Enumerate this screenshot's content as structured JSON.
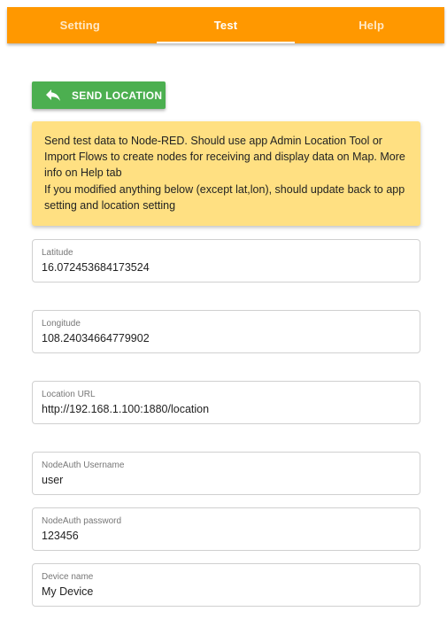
{
  "tabs": [
    {
      "label": "Setting"
    },
    {
      "label": "Test"
    },
    {
      "label": "Help"
    }
  ],
  "active_tab": "Test",
  "send_button": {
    "label": "SEND LOCATION",
    "icon": "reply-arrow-icon"
  },
  "notice": {
    "line1": "Send test data to Node-RED. Should use app Admin Location Tool or Import Flows to create nodes for receiving and display data on Map. More info on Help tab",
    "line2": "If you modified anything below (except lat,lon), should update back to app setting and location setting"
  },
  "fields": {
    "latitude": {
      "label": "Latitude",
      "value": "16.072453684173524"
    },
    "longitude": {
      "label": "Longitude",
      "value": "108.24034664779902"
    },
    "location_url": {
      "label": "Location URL",
      "value": "http://192.168.1.100:1880/location"
    },
    "username": {
      "label": "NodeAuth Username",
      "value": "user"
    },
    "password": {
      "label": "NodeAuth password",
      "value": "123456"
    },
    "device_name": {
      "label": "Device name",
      "value": "My Device"
    }
  },
  "colors": {
    "tabbar": "#ff9800",
    "send_button": "#4caf50",
    "notice_bg": "#ffe082"
  }
}
